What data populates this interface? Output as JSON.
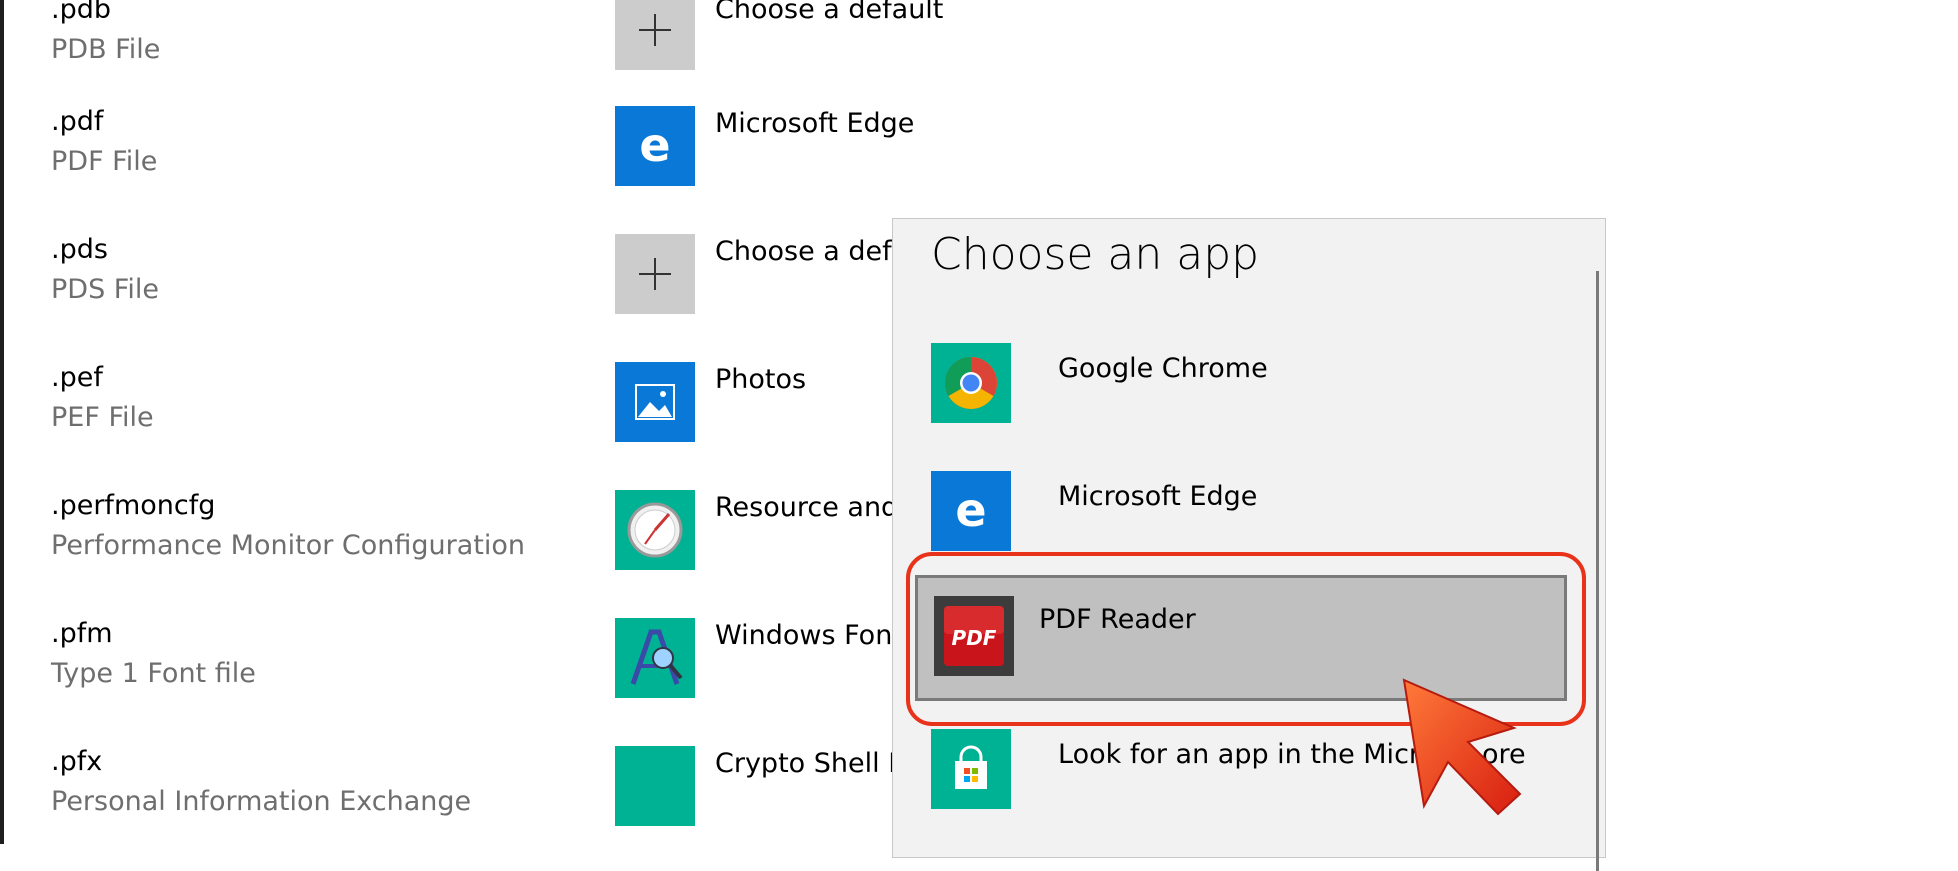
{
  "file_associations": [
    {
      "extension": ".pdb",
      "description": "PDB File",
      "app": "Choose a default",
      "icon": "plus-icon"
    },
    {
      "extension": ".pdf",
      "description": "PDF File",
      "app": "Microsoft Edge",
      "icon": "edge-icon"
    },
    {
      "extension": ".pds",
      "description": "PDS File",
      "app": "Choose a defa",
      "icon": "plus-icon"
    },
    {
      "extension": ".pef",
      "description": "PEF File",
      "app": "Photos",
      "icon": "photos-icon"
    },
    {
      "extension": ".perfmoncfg",
      "description": "Performance Monitor Configuration",
      "app": "Resource and",
      "icon": "resource-monitor-icon"
    },
    {
      "extension": ".pfm",
      "description": "Type 1 Font file",
      "app": "Windows Fon",
      "icon": "font-viewer-icon"
    },
    {
      "extension": ".pfx",
      "description": "Personal Information Exchange",
      "app": "Crypto Shell E",
      "icon": "crypto-shell-icon"
    }
  ],
  "popup": {
    "title": "Choose an app",
    "items": [
      {
        "label": "Google Chrome",
        "icon": "chrome-icon"
      },
      {
        "label": "Microsoft Edge",
        "icon": "edge-icon"
      },
      {
        "label": "PDF Reader",
        "icon": "pdf-reader-icon",
        "selected": true,
        "icon_text": "PDF"
      },
      {
        "label": "Look for an app in the Micro",
        "label_tail": "ore",
        "icon": "store-icon"
      }
    ]
  },
  "colors": {
    "tile_blue": "#0a78d7",
    "tile_teal": "#00b294",
    "tile_gray": "#cccccc",
    "highlight": "#e8321a",
    "selected_bg": "#c0c0c0"
  }
}
